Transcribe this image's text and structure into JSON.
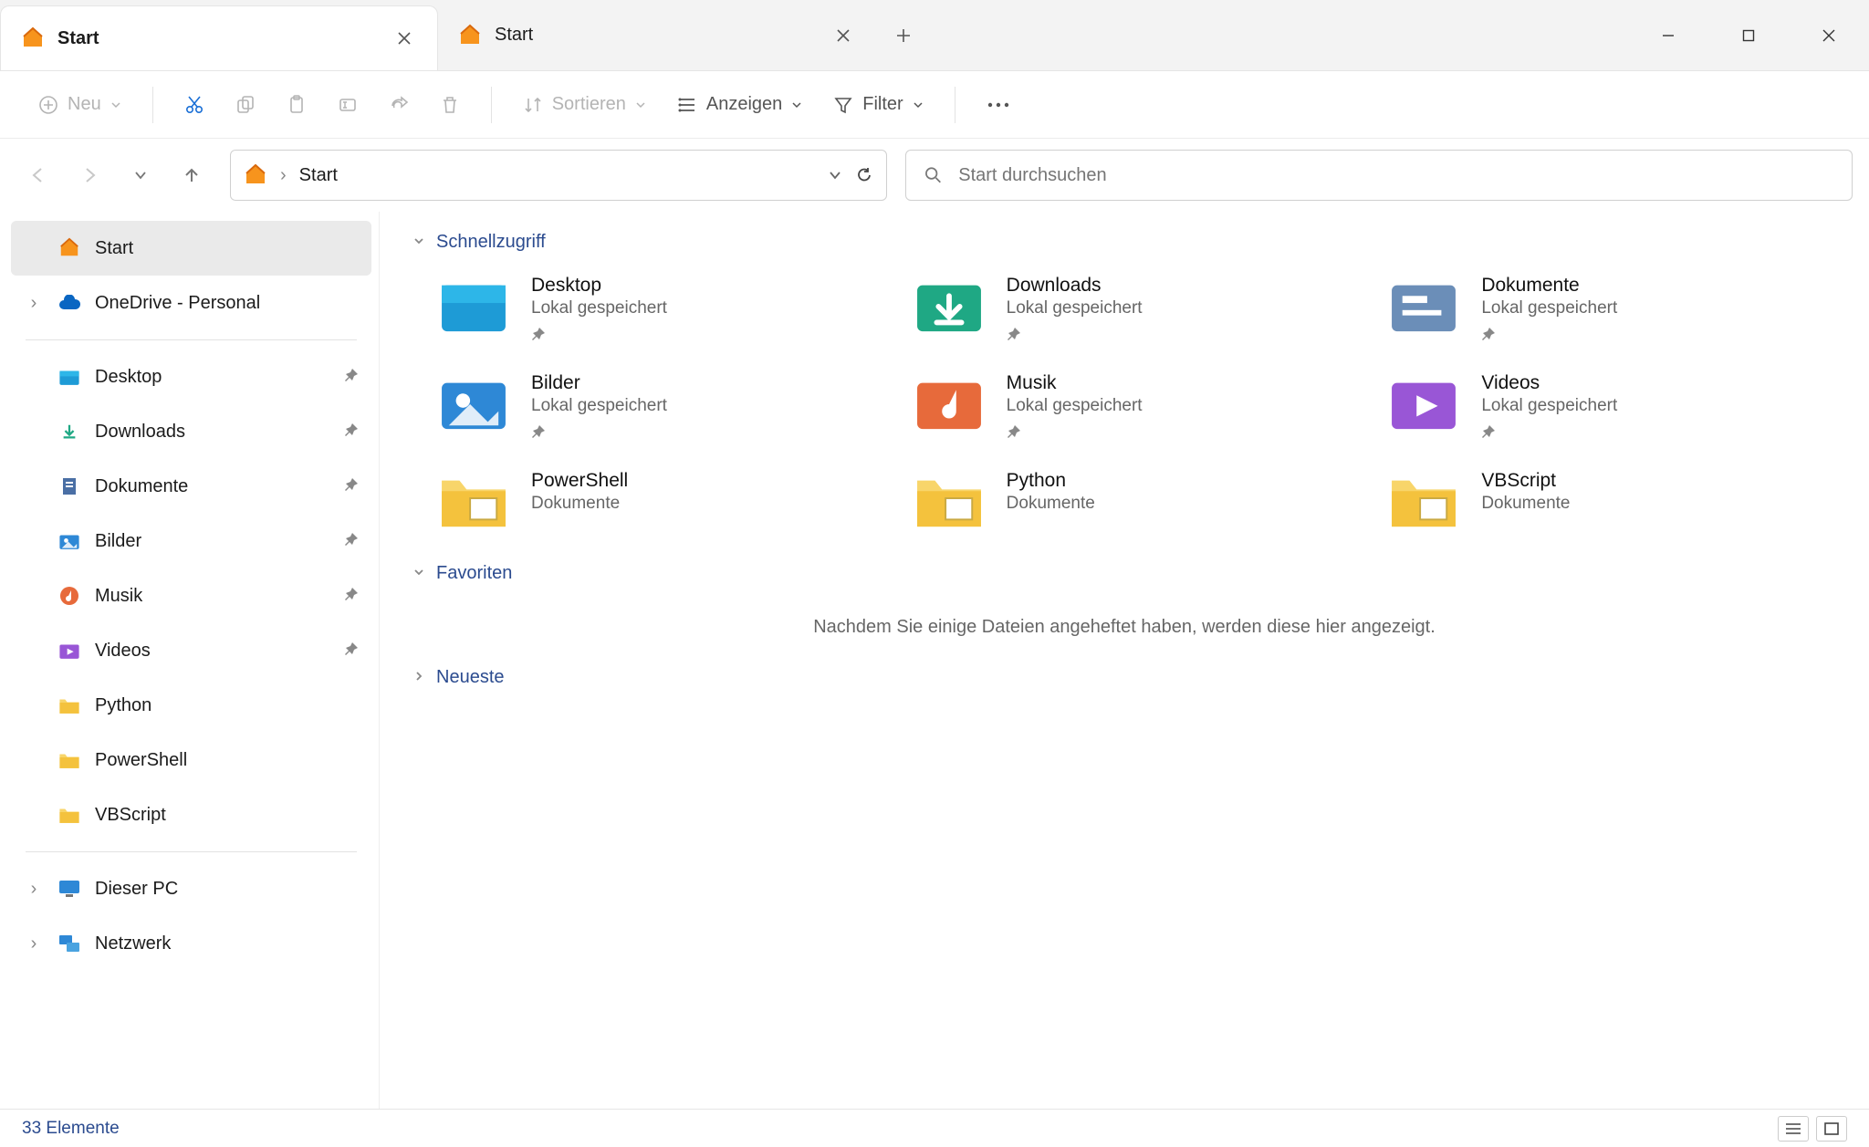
{
  "tabs": [
    {
      "label": "Start",
      "active": true
    },
    {
      "label": "Start",
      "active": false
    }
  ],
  "toolbar": {
    "new": "Neu",
    "sort": "Sortieren",
    "view": "Anzeigen",
    "filter": "Filter"
  },
  "breadcrumb": {
    "location": "Start"
  },
  "search": {
    "placeholder": "Start durchsuchen"
  },
  "sidebar": {
    "home": "Start",
    "onedrive": "OneDrive - Personal",
    "pinned": [
      {
        "label": "Desktop",
        "icon": "desktop"
      },
      {
        "label": "Downloads",
        "icon": "downloads"
      },
      {
        "label": "Dokumente",
        "icon": "documents"
      },
      {
        "label": "Bilder",
        "icon": "pictures"
      },
      {
        "label": "Musik",
        "icon": "music"
      },
      {
        "label": "Videos",
        "icon": "videos"
      }
    ],
    "folders": [
      {
        "label": "Python"
      },
      {
        "label": "PowerShell"
      },
      {
        "label": "VBScript"
      }
    ],
    "thispc": "Dieser PC",
    "network": "Netzwerk"
  },
  "sections": {
    "quick": "Schnellzugriff",
    "favorites": "Favoriten",
    "recent": "Neueste"
  },
  "quick_items": [
    {
      "title": "Desktop",
      "sub": "Lokal gespeichert",
      "icon": "desktop",
      "pinned": true
    },
    {
      "title": "Downloads",
      "sub": "Lokal gespeichert",
      "icon": "downloads",
      "pinned": true
    },
    {
      "title": "Dokumente",
      "sub": "Lokal gespeichert",
      "icon": "documents",
      "pinned": true
    },
    {
      "title": "Bilder",
      "sub": "Lokal gespeichert",
      "icon": "pictures",
      "pinned": true
    },
    {
      "title": "Musik",
      "sub": "Lokal gespeichert",
      "icon": "music",
      "pinned": true
    },
    {
      "title": "Videos",
      "sub": "Lokal gespeichert",
      "icon": "videos",
      "pinned": true
    },
    {
      "title": "PowerShell",
      "sub": "Dokumente",
      "icon": "folder",
      "pinned": false
    },
    {
      "title": "Python",
      "sub": "Dokumente",
      "icon": "folder",
      "pinned": false
    },
    {
      "title": "VBScript",
      "sub": "Dokumente",
      "icon": "folder",
      "pinned": false
    }
  ],
  "favorites_empty": "Nachdem Sie einige Dateien angeheftet haben, werden diese hier angezeigt.",
  "status": {
    "count": "33 Elemente"
  }
}
